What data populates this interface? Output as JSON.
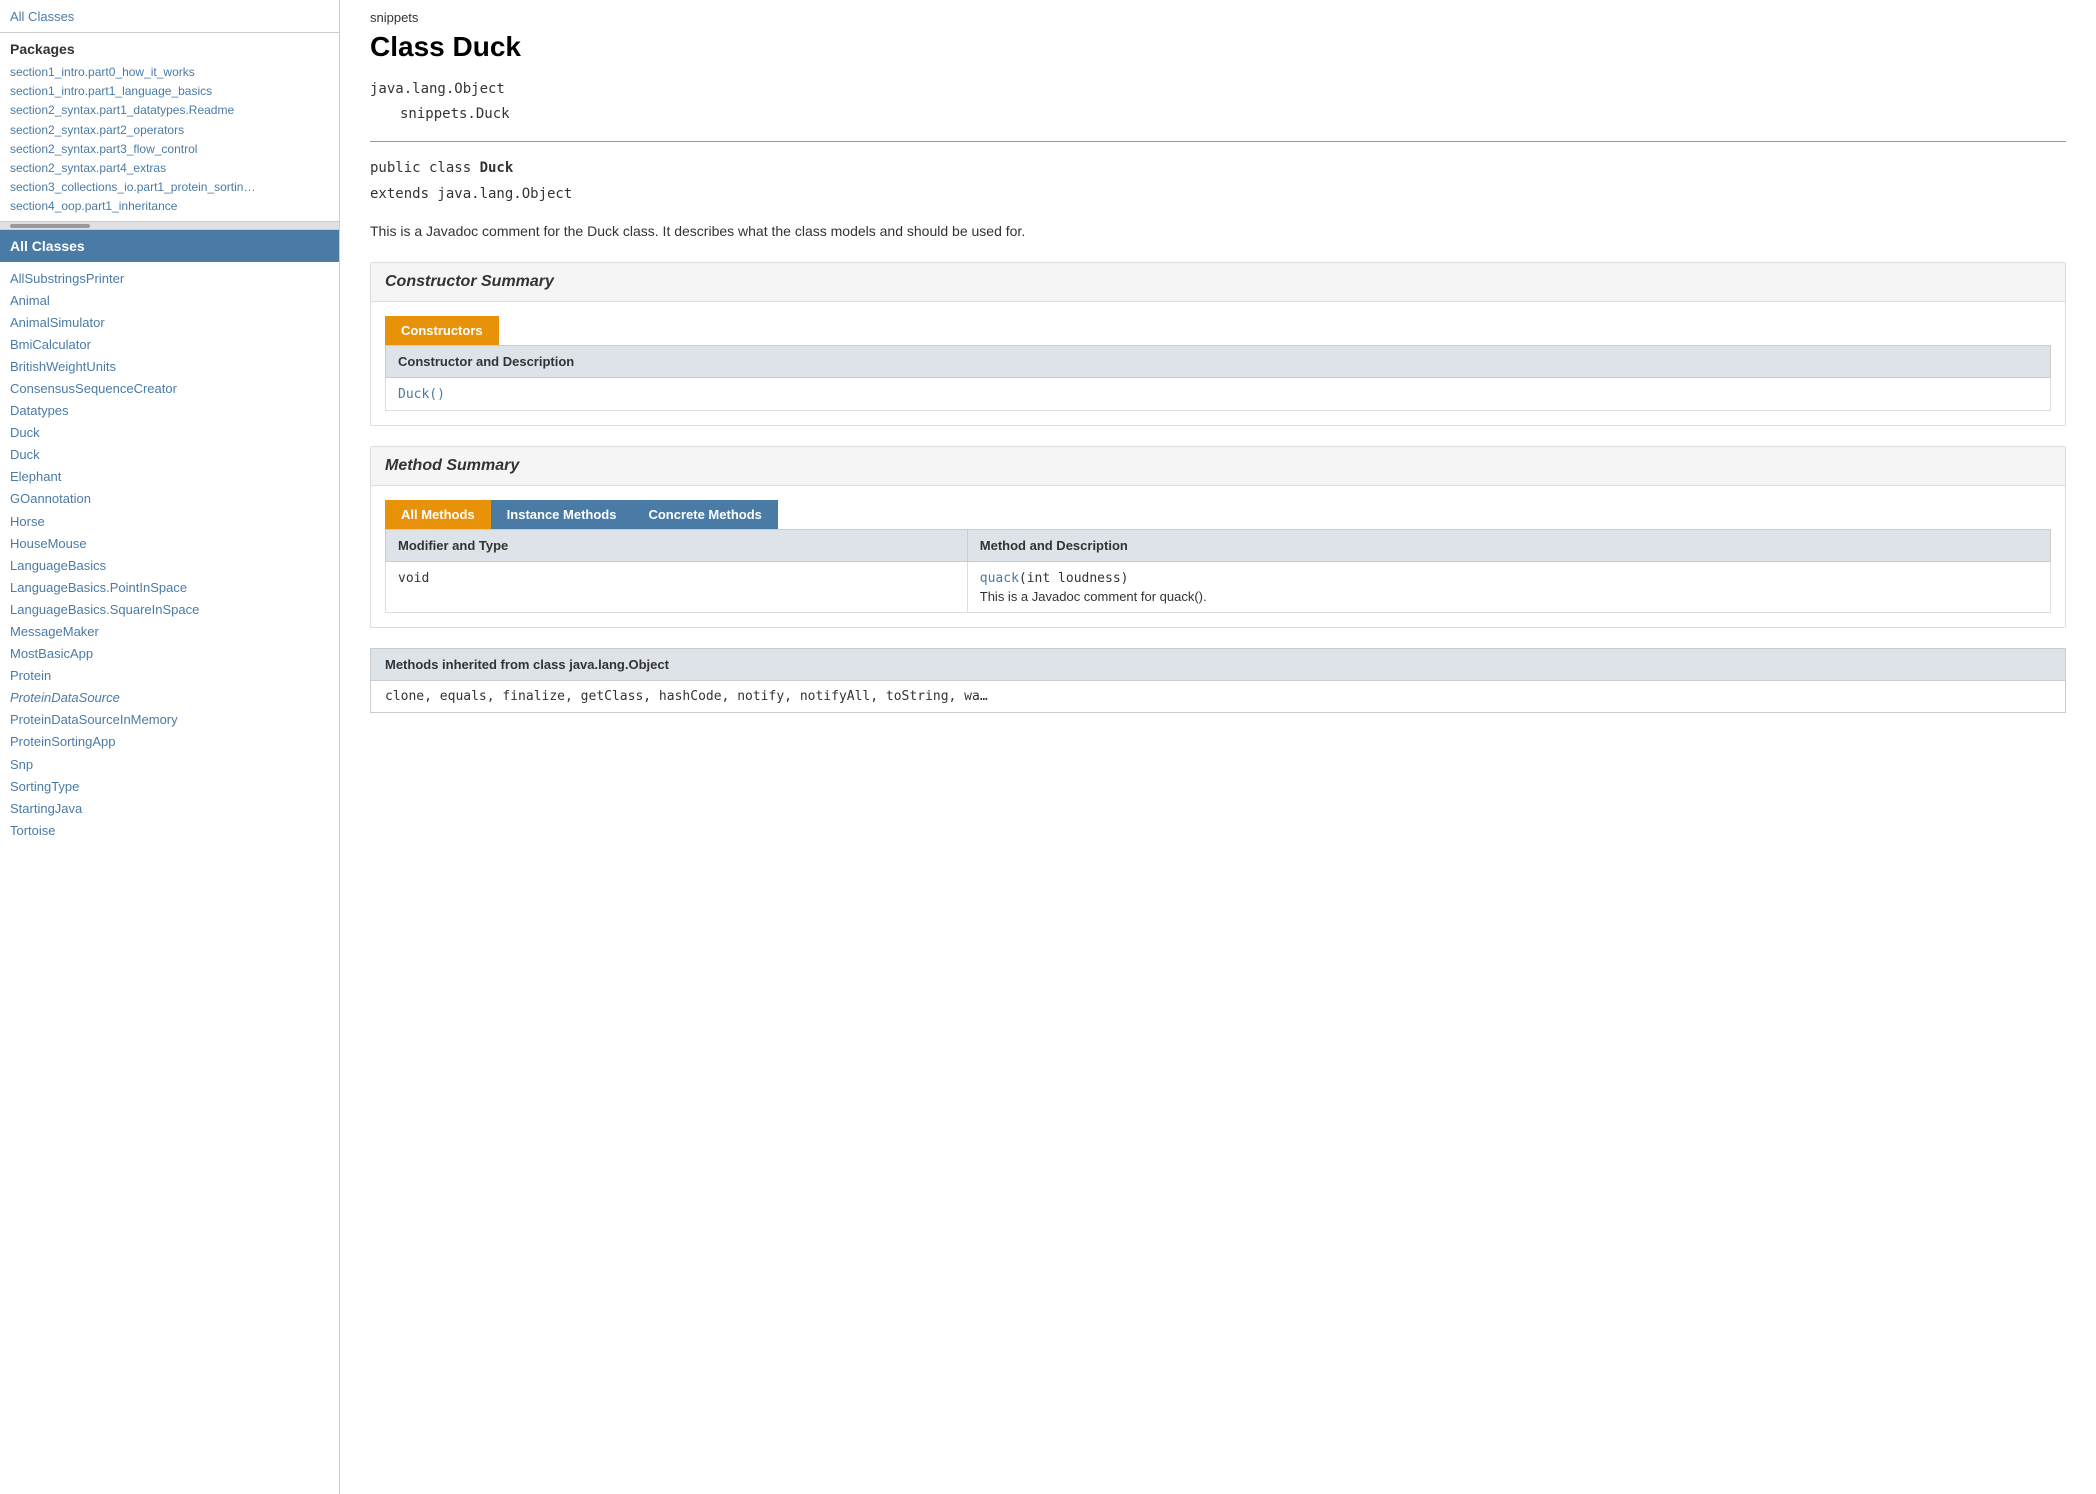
{
  "sidebar": {
    "all_classes_link": "All Classes",
    "packages_heading": "Packages",
    "all_classes_header": "All Classes",
    "packages": [
      "section1_intro.part0_how_it_works",
      "section1_intro.part1_language_basics",
      "section2_syntax.part1_datatypes.Readme",
      "section2_syntax.part2_operators",
      "section2_syntax.part3_flow_control",
      "section2_syntax.part4_extras",
      "section3_collections_io.part1_protein_sortin…",
      "section4_oop.part1_inheritance"
    ],
    "classes": [
      {
        "name": "AllSubstringsPrinter",
        "italic": false
      },
      {
        "name": "Animal",
        "italic": false
      },
      {
        "name": "AnimalSimulator",
        "italic": false
      },
      {
        "name": "BmiCalculator",
        "italic": false
      },
      {
        "name": "BritishWeightUnits",
        "italic": false
      },
      {
        "name": "ConsensusSequenceCreator",
        "italic": false
      },
      {
        "name": "Datatypes",
        "italic": false
      },
      {
        "name": "Duck",
        "italic": false
      },
      {
        "name": "Duck",
        "italic": false
      },
      {
        "name": "Elephant",
        "italic": false
      },
      {
        "name": "GOannotation",
        "italic": false
      },
      {
        "name": "Horse",
        "italic": false
      },
      {
        "name": "HouseMouse",
        "italic": false
      },
      {
        "name": "LanguageBasics",
        "italic": false
      },
      {
        "name": "LanguageBasics.PointInSpace",
        "italic": false
      },
      {
        "name": "LanguageBasics.SquareInSpace",
        "italic": false
      },
      {
        "name": "MessageMaker",
        "italic": false
      },
      {
        "name": "MostBasicApp",
        "italic": false
      },
      {
        "name": "Protein",
        "italic": false
      },
      {
        "name": "ProteinDataSource",
        "italic": true
      },
      {
        "name": "ProteinDataSourceInMemory",
        "italic": false
      },
      {
        "name": "ProteinSortingApp",
        "italic": false
      },
      {
        "name": "Snp",
        "italic": false
      },
      {
        "name": "SortingType",
        "italic": false
      },
      {
        "name": "StartingJava",
        "italic": false
      },
      {
        "name": "Tortoise",
        "italic": false
      }
    ]
  },
  "main": {
    "breadcrumb": "snippets",
    "class_title": "Class Duck",
    "inheritance": {
      "parent": "java.lang.Object",
      "child": "snippets.Duck"
    },
    "signature_line1": "public class ",
    "signature_bold": "Duck",
    "signature_line2": "extends java.lang.Object",
    "description": "This is a Javadoc comment for the Duck class. It describes what the class models and should be used for.",
    "constructor_summary": {
      "title": "Constructor Summary",
      "tab_label": "Constructors",
      "table_header": "Constructor and Description",
      "rows": [
        {
          "constructor": "Duck()",
          "description": ""
        }
      ]
    },
    "method_summary": {
      "title": "Method Summary",
      "tabs": [
        {
          "label": "All Methods",
          "active": true
        },
        {
          "label": "Instance Methods",
          "active": false
        },
        {
          "label": "Concrete Methods",
          "active": false
        }
      ],
      "columns": [
        "Modifier and Type",
        "Method and Description"
      ],
      "rows": [
        {
          "modifier": "void",
          "method_link": "quack",
          "method_params": "(int loudness)",
          "description": "This is a Javadoc comment for quack()."
        }
      ]
    },
    "inherited": {
      "header": "Methods inherited from class java.lang.Object",
      "methods": "clone, equals, finalize, getClass, hashCode, notify, notifyAll, toString, wa…"
    }
  }
}
